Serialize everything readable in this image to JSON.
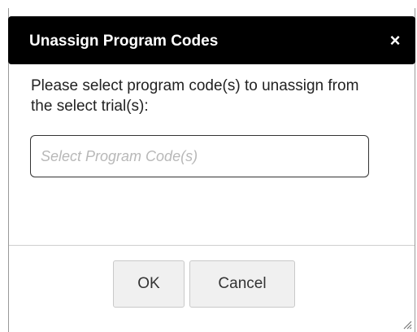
{
  "dialog": {
    "title": "Unassign Program Codes",
    "close_label": "×",
    "message": "Please select program code(s) to unassign from the select trial(s):",
    "select": {
      "placeholder": "Select Program Code(s)",
      "value": ""
    },
    "buttons": {
      "ok_label": "OK",
      "cancel_label": "Cancel"
    }
  },
  "icons": {
    "close": "close-icon",
    "resize": "resize-grip-icon"
  },
  "colors": {
    "titlebar_bg": "#000000",
    "title_text": "#ffffff",
    "button_bg": "#f0f0f0",
    "placeholder": "#b8b8b8"
  }
}
